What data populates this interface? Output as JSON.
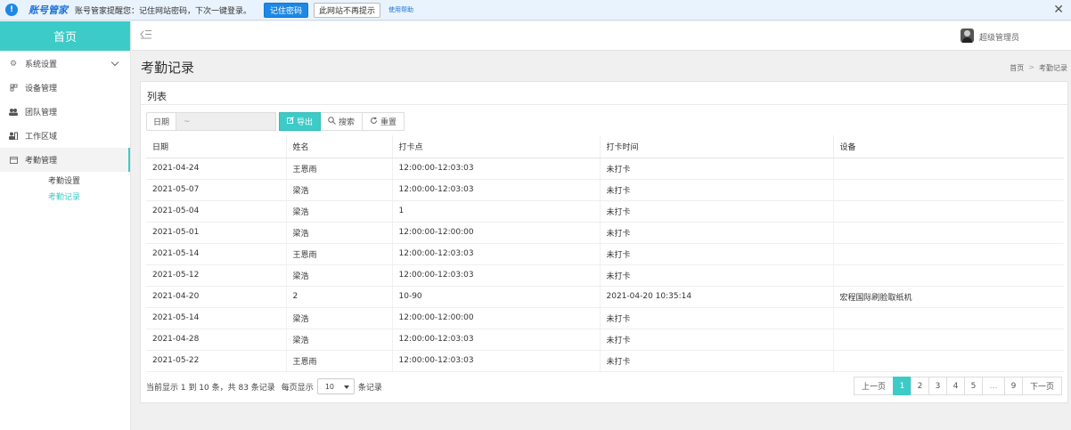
{
  "notification": {
    "brand": "账号管家",
    "message": "账号管家提醒您：记住网站密码，下次一键登录。",
    "remember_button": "记住密码",
    "never_button": "此网站不再提示",
    "help_link": "使用帮助",
    "close": "✕"
  },
  "sidebar": {
    "home": "首页",
    "items": [
      {
        "label": "系统设置",
        "icon": "gear-icon"
      },
      {
        "label": "设备管理",
        "icon": "device-icon"
      },
      {
        "label": "团队管理",
        "icon": "team-icon"
      },
      {
        "label": "工作区域",
        "icon": "area-icon"
      },
      {
        "label": "考勤管理",
        "icon": "calendar-icon"
      }
    ],
    "submenu": [
      {
        "label": "考勤设置"
      },
      {
        "label": "考勤记录"
      }
    ]
  },
  "topbar": {
    "user_name": "超级管理员"
  },
  "page": {
    "title": "考勤记录",
    "breadcrumb": [
      "首页",
      "考勤记录"
    ],
    "card_title": "列表"
  },
  "toolbar": {
    "date_label": "日期",
    "date_placeholder": "~",
    "export_label": "导出",
    "search_label": "搜索",
    "reset_label": "重置"
  },
  "table": {
    "columns": [
      "日期",
      "姓名",
      "打卡点",
      "打卡时间",
      "设备"
    ],
    "rows": [
      [
        "2021-04-24",
        "王恩雨",
        "12:00:00-12:03:03",
        "未打卡",
        ""
      ],
      [
        "2021-05-07",
        "梁浩",
        "12:00:00-12:03:03",
        "未打卡",
        ""
      ],
      [
        "2021-05-04",
        "梁浩",
        "1",
        "未打卡",
        ""
      ],
      [
        "2021-05-01",
        "梁浩",
        "12:00:00-12:00:00",
        "未打卡",
        ""
      ],
      [
        "2021-05-14",
        "王恩雨",
        "12:00:00-12:03:03",
        "未打卡",
        ""
      ],
      [
        "2021-05-12",
        "梁浩",
        "12:00:00-12:03:03",
        "未打卡",
        ""
      ],
      [
        "2021-04-20",
        "2",
        "10-90",
        "2021-04-20 10:35:14",
        "宏程国际刷脸取纸机"
      ],
      [
        "2021-05-14",
        "梁浩",
        "12:00:00-12:00:00",
        "未打卡",
        ""
      ],
      [
        "2021-04-28",
        "梁浩",
        "12:00:00-12:03:03",
        "未打卡",
        ""
      ],
      [
        "2021-05-22",
        "王恩雨",
        "12:00:00-12:03:03",
        "未打卡",
        ""
      ]
    ]
  },
  "footer": {
    "info": "当前显示 1 到 10 条，共 83 条记录",
    "per_page_prefix": "每页显示",
    "per_page_value": "10",
    "per_page_suffix": "条记录"
  },
  "pagination": {
    "prev": "上一页",
    "pages": [
      "1",
      "2",
      "3",
      "4",
      "5",
      "…",
      "9"
    ],
    "next": "下一页",
    "current": "1"
  },
  "colors": {
    "accent": "#3ccbc7",
    "notification_blue": "#1e88e5"
  }
}
